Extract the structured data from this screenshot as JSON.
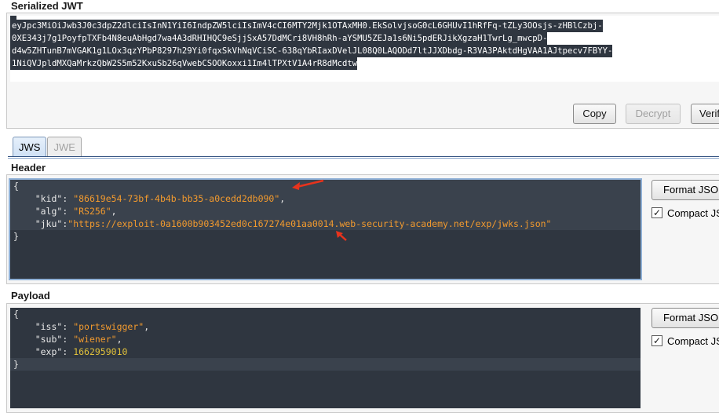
{
  "serialized": {
    "title": "Serialized JWT",
    "lines": [
      "eyJpc3MiOiJwb3J0c3dpZ2dlciIsInN1YiI6IndpZW5lciIsImV4cCI6MTY2Mjk1OTAxMH0.EkSolvjsoG0cL6GHUvI1hRfFq-tZLy3OOsjs-zHBlCzbj-",
      "0XE343j7g1PoyfpTXFb4N8euAbHgd7wa4A3dRHIHQC9eSjjSxA57DdMCri8VH8hRh-aYSMU5ZEJa1s6Ni5pdERJikXgzaH1TwrLg_mwcpD-",
      "d4w5ZHTunB7mVGAK1g1LOx3qzYPbP8297h29Yi0fqxSkVhNqVCiSC-638qYbRIaxDVelJL08Q0LAQODd7ltJJXDbdg-R3VA3PAktdHgVAA1AJtpecv7FBYY-",
      "1NiQVJpldMXQaMrkzQbW2S5m52KxuSb26qVwebCSOOKoxxi1Im4lTPXtV1A4rR8dMcdtw"
    ]
  },
  "actions": {
    "copy": "Copy",
    "decrypt": "Decrypt",
    "verify": "Verify"
  },
  "tabs": {
    "jws": "JWS",
    "jwe": "JWE"
  },
  "header": {
    "title": "Header",
    "open": "{",
    "close": "}",
    "kid_key": "\"kid\"",
    "kid_value": "\"86619e54-73bf-4b4b-bb35-a0cedd2db090\"",
    "alg_key": "\"alg\"",
    "alg_value": "\"RS256\"",
    "jku_key": "\"jku\"",
    "jku_value": "\"https://exploit-0a1600b903452ed0c167274e01aa0014.web-security-academy.net/exp/jwks.json\"",
    "format_button": "Format JSON",
    "compact_label": "Compact JSON"
  },
  "payload": {
    "title": "Payload",
    "open": "{",
    "close": "}",
    "iss_key": "\"iss\"",
    "iss_value": "\"portswigger\"",
    "sub_key": "\"sub\"",
    "sub_value": "\"wiener\"",
    "exp_key": "\"exp\"",
    "exp_value": "1662959010",
    "format_button": "Format JSON",
    "compact_label": "Compact JSON"
  },
  "checkmark": "✓",
  "colors": {
    "editor_bg": "#2f3640",
    "string": "#f29a2e",
    "number": "#e0c03a",
    "annotation_arrow": "#e8331c",
    "tab_active": "#cfe0f4"
  }
}
